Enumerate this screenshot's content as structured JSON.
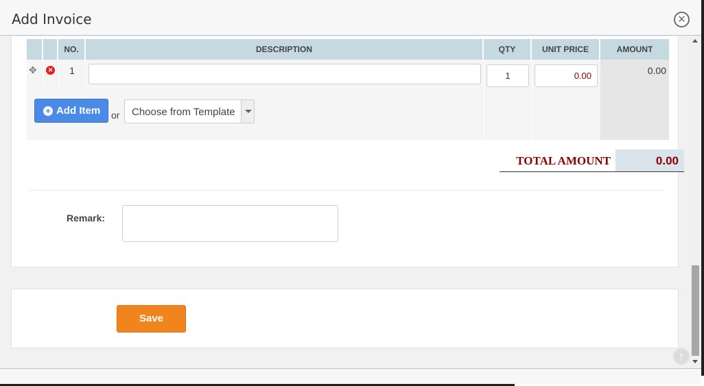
{
  "modal": {
    "title": "Add Invoice"
  },
  "table": {
    "headers": {
      "no": "NO.",
      "description": "DESCRIPTION",
      "qty": "QTY",
      "unit_price": "UNIT PRICE",
      "amount": "AMOUNT"
    },
    "rows": [
      {
        "no": "1",
        "description": "",
        "qty": "1",
        "unit_price": "0.00",
        "amount": "0.00"
      }
    ]
  },
  "actions": {
    "add_item": "Add Item",
    "or": "or",
    "template_select": "Choose from Template"
  },
  "totals": {
    "label": "TOTAL AMOUNT",
    "value": "0.00"
  },
  "remark": {
    "label": "Remark:",
    "value": ""
  },
  "footer": {
    "save": "Save"
  },
  "icons": {
    "close": "close-icon",
    "move": "move-icon",
    "delete": "delete-icon",
    "add": "plus-circle-icon",
    "back_to_top": "arrow-up-icon"
  },
  "colors": {
    "accent_blue": "#4a8be8",
    "save_orange": "#f2841e",
    "total_red": "#8b0000",
    "header_blue": "#c5d9e0"
  }
}
